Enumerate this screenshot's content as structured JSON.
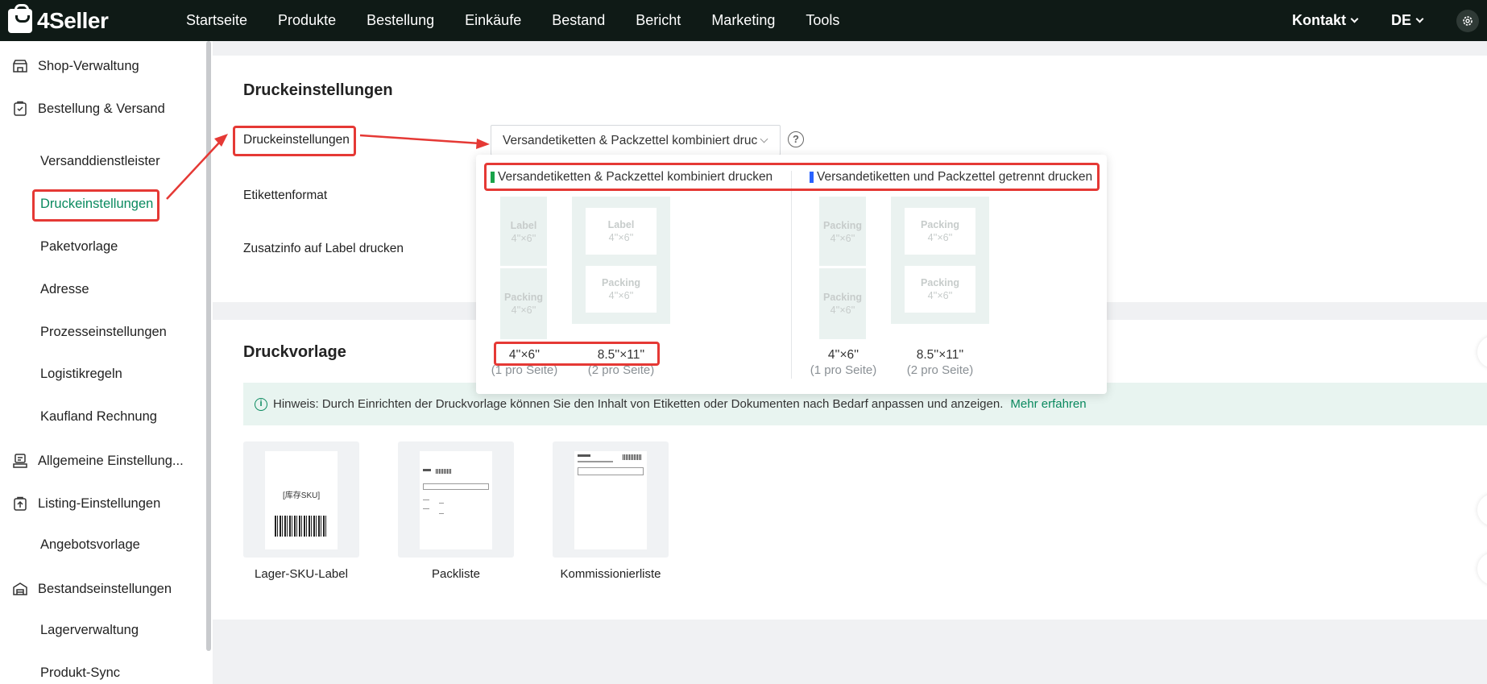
{
  "brand": {
    "name": "4Seller"
  },
  "nav": {
    "items": [
      "Startseite",
      "Produkte",
      "Bestellung",
      "Einkäufe",
      "Bestand",
      "Bericht",
      "Marketing",
      "Tools"
    ],
    "contact": "Kontakt",
    "lang": "DE",
    "settings_icon": "gear-icon"
  },
  "sidebar": {
    "items": [
      {
        "label": "Shop-Verwaltung",
        "icon": "shop-icon"
      },
      {
        "label": "Bestellung & Versand",
        "icon": "order-icon"
      },
      {
        "label": "Versanddienstleister"
      },
      {
        "label": "Druckeinstellungen",
        "active": true
      },
      {
        "label": "Paketvorlage"
      },
      {
        "label": "Adresse"
      },
      {
        "label": "Prozesseinstellungen"
      },
      {
        "label": "Logistikregeln"
      },
      {
        "label": "Kaufland Rechnung"
      },
      {
        "label": "Allgemeine Einstellung...",
        "icon": "printer-icon"
      },
      {
        "label": "Listing-Einstellungen",
        "icon": "upload-bag-icon"
      },
      {
        "label": "Angebotsvorlage"
      },
      {
        "label": "Bestandseinstellungen",
        "icon": "warehouse-icon"
      },
      {
        "label": "Lagerverwaltung"
      },
      {
        "label": "Produkt-Sync"
      }
    ]
  },
  "print_settings": {
    "title": "Druckeinstellungen",
    "row_label": "Druckeinstellungen",
    "select_value": "Versandetiketten & Packzettel kombiniert druc",
    "format_label": "Etikettenformat",
    "extra_label": "Zusatzinfo auf Label drucken"
  },
  "popup": {
    "option_combined": "Versandetiketten & Packzettel kombiniert drucken",
    "option_separate": "Versandetiketten und Packzettel getrennt drucken",
    "combined_color": "#1aa34a",
    "separate_color": "#2962ff",
    "tile_label": "Label",
    "tile_packing": "Packing",
    "tile_dim": "4''×6''",
    "size_small": "4''×6''",
    "size_large": "8.5''×11''",
    "per_page_one": "(1 pro Seite)",
    "per_page_two": "(2 pro Seite)"
  },
  "templates": {
    "title": "Druckvorlage",
    "hint": "Hinweis: Durch Einrichten der Druckvorlage können Sie den Inhalt von Etiketten oder Dokumenten nach Bedarf anpassen und anzeigen.",
    "hint_link": "Mehr erfahren",
    "items": [
      {
        "name": "Lager-SKU-Label",
        "preview_text": "[库存SKU]"
      },
      {
        "name": "Packliste"
      },
      {
        "name": "Kommissionierliste"
      }
    ]
  },
  "colors": {
    "topbar": "#0f1a16",
    "accent": "#0a8a5f",
    "annotation": "#e53935"
  }
}
